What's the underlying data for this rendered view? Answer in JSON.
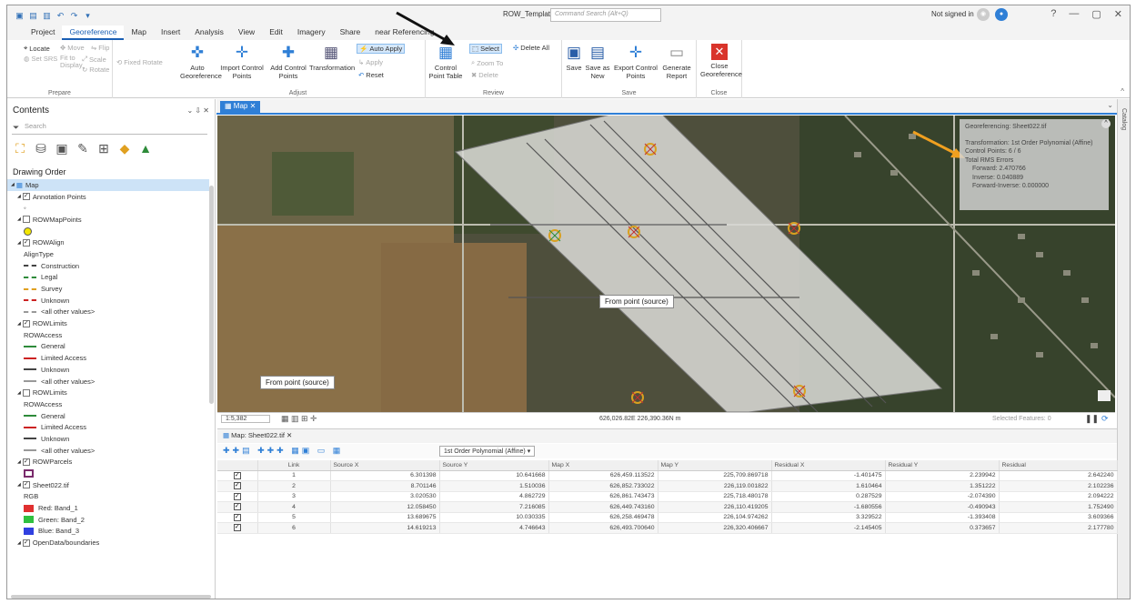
{
  "title_bar": {
    "doc_title": "ROW_Template",
    "search_placeholder": "Command Search (Alt+Q)",
    "signin": "Not signed in",
    "help": "?"
  },
  "ribbon_tabs": [
    "Project",
    "Georeference",
    "Map",
    "Insert",
    "Analysis",
    "View",
    "Edit",
    "Imagery",
    "Share",
    "Linear Referencing"
  ],
  "ribbon_tabs_visible": [
    "Project",
    "Georeference",
    "Map",
    "Insert",
    "Analysis",
    "View",
    "Edit",
    "Imagery",
    "Share",
    "near Referencing"
  ],
  "active_tab": "Georeference",
  "ribbon": {
    "prepare": {
      "label": "Prepare",
      "locate": "Locate",
      "move": "Move",
      "flip": "Flip",
      "set_srs": "Set SRS",
      "fit_to_display": "Fit to Display",
      "scale": "Scale",
      "fixed_rotate": "Fixed Rotate",
      "rotate": "Rotate"
    },
    "adjust": {
      "label": "Adjust",
      "auto_georeference": "Auto Georeference",
      "import_control_points": "Import Control Points",
      "add_control_points": "Add Control Points",
      "transformation": "Transformation",
      "auto_apply": "Auto Apply",
      "apply": "Apply",
      "reset": "Reset"
    },
    "review": {
      "label": "Review",
      "control_point_table": "Control Point Table",
      "select": "Select",
      "zoom_to": "Zoom To",
      "delete": "Delete",
      "delete_all": "Delete All"
    },
    "save": {
      "label": "Save",
      "save": "Save",
      "save_as_new": "Save as New",
      "export_control_points": "Export Control Points",
      "generate_report": "Generate Report"
    },
    "close": {
      "label": "Close",
      "close_georeference": "Close Georeference"
    }
  },
  "contents": {
    "title": "Contents",
    "search_placeholder": "Search",
    "drawing_order": "Drawing Order",
    "items": [
      {
        "type": "layer",
        "label": "Map",
        "checked": null,
        "indent": 0,
        "selected": true
      },
      {
        "type": "layer",
        "label": "Annotation Points",
        "checked": true,
        "indent": 1
      },
      {
        "type": "sym",
        "sym": "dot",
        "label": "",
        "indent": 2
      },
      {
        "type": "layer",
        "label": "ROWMapPoints",
        "checked": false,
        "indent": 1
      },
      {
        "type": "sym",
        "sym": "yellow-circle",
        "label": "",
        "indent": 2
      },
      {
        "type": "layer",
        "label": "ROWAlign",
        "checked": true,
        "indent": 1
      },
      {
        "type": "text",
        "label": "AlignType",
        "indent": 2
      },
      {
        "type": "sym",
        "sym": "dash",
        "color": "#444444",
        "label": "Construction",
        "indent": 2
      },
      {
        "type": "sym",
        "sym": "dash",
        "color": "#2e8b3a",
        "label": "Legal",
        "indent": 2
      },
      {
        "type": "sym",
        "sym": "dash",
        "color": "#e0a020",
        "label": "Survey",
        "indent": 2
      },
      {
        "type": "sym",
        "sym": "dash",
        "color": "#cc2222",
        "label": "Unknown",
        "indent": 2
      },
      {
        "type": "sym",
        "sym": "dash",
        "color": "#999999",
        "label": "<all other values>",
        "indent": 2
      },
      {
        "type": "layer",
        "label": "ROWLimits",
        "checked": true,
        "indent": 1
      },
      {
        "type": "text",
        "label": "ROWAccess",
        "indent": 2
      },
      {
        "type": "sym",
        "sym": "line",
        "color": "#2e8b3a",
        "label": "General",
        "indent": 2
      },
      {
        "type": "sym",
        "sym": "line",
        "color": "#cc2222",
        "label": "Limited Access",
        "indent": 2
      },
      {
        "type": "sym",
        "sym": "line",
        "color": "#444444",
        "label": "Unknown",
        "indent": 2
      },
      {
        "type": "sym",
        "sym": "line",
        "color": "#999999",
        "label": "<all other values>",
        "indent": 2
      },
      {
        "type": "layer",
        "label": "ROWLimits",
        "checked": false,
        "indent": 1
      },
      {
        "type": "text",
        "label": "ROWAccess",
        "indent": 2
      },
      {
        "type": "sym",
        "sym": "line",
        "color": "#2e8b3a",
        "label": "General",
        "indent": 2
      },
      {
        "type": "sym",
        "sym": "line",
        "color": "#cc2222",
        "label": "Limited Access",
        "indent": 2
      },
      {
        "type": "sym",
        "sym": "line",
        "color": "#444444",
        "label": "Unknown",
        "indent": 2
      },
      {
        "type": "sym",
        "sym": "line",
        "color": "#999999",
        "label": "<all other values>",
        "indent": 2
      },
      {
        "type": "layer",
        "label": "ROWParcels",
        "checked": true,
        "indent": 1
      },
      {
        "type": "sym",
        "sym": "purple-box",
        "label": "",
        "indent": 2
      },
      {
        "type": "layer",
        "label": "Sheet022.tif",
        "checked": true,
        "indent": 1
      },
      {
        "type": "text",
        "label": "RGB",
        "indent": 2
      },
      {
        "type": "sym",
        "sym": "box",
        "color": "#e03030",
        "label": "Red:  Band_1",
        "indent": 2
      },
      {
        "type": "sym",
        "sym": "box",
        "color": "#30c040",
        "label": "Green: Band_2",
        "indent": 2
      },
      {
        "type": "sym",
        "sym": "box",
        "color": "#3040e0",
        "label": "Blue:  Band_3",
        "indent": 2
      },
      {
        "type": "layer",
        "label": "OpenData/boundaries",
        "checked": true,
        "indent": 1
      }
    ]
  },
  "map": {
    "tab_label": "Map",
    "info_box": {
      "title": "Georeferencing: Sheet022.tif",
      "transformation": "Transformation: 1st Order Polynomial (Affine)",
      "control_points": "Control Points: 6 / 6",
      "total_rms": "Total RMS Errors",
      "forward": "Forward: 2.470766",
      "inverse": "Inverse: 0.040889",
      "forward_inverse": "Forward-Inverse: 0.000000"
    },
    "source_label_1": "From point (source)",
    "source_label_2": "From point (source)",
    "scale": "1:5,382",
    "coordinates": "626,026.82E 226,390.36N m",
    "selected_features": "Selected Features: 0"
  },
  "table": {
    "tab_label": "Map: Sheet022.tif",
    "transformation_dropdown": "1st Order Polynomial (Affine)",
    "columns": [
      "",
      "Link",
      "Source X",
      "Source Y",
      "Map X",
      "Map Y",
      "Residual X",
      "Residual Y",
      "Residual"
    ],
    "rows": [
      [
        "1",
        "6.301398",
        "10.641668",
        "626,459.113522",
        "225,709.869718",
        "-1.401475",
        "2.239942",
        "2.642240"
      ],
      [
        "2",
        "8.701146",
        "1.510036",
        "626,852.733022",
        "226,119.001822",
        "1.610464",
        "1.351222",
        "2.102236"
      ],
      [
        "3",
        "3.020530",
        "4.862729",
        "626,861.743473",
        "225,718.480178",
        "0.287529",
        "-2.074390",
        "2.094222"
      ],
      [
        "4",
        "12.058450",
        "7.216085",
        "626,449.743160",
        "226,110.419205",
        "-1.680556",
        "-0.490943",
        "1.752490"
      ],
      [
        "5",
        "13.689675",
        "10.030335",
        "626,258.469478",
        "226,104.974262",
        "3.329522",
        "-1.393408",
        "3.609366"
      ],
      [
        "6",
        "14.619213",
        "4.746643",
        "626,493.700640",
        "226,320.406667",
        "-2.145405",
        "0.373657",
        "2.177780"
      ]
    ]
  },
  "catalog_label": "Catalog",
  "colors": {
    "accent": "#2f7fd6",
    "arrow_annotation": "#f0a020"
  }
}
